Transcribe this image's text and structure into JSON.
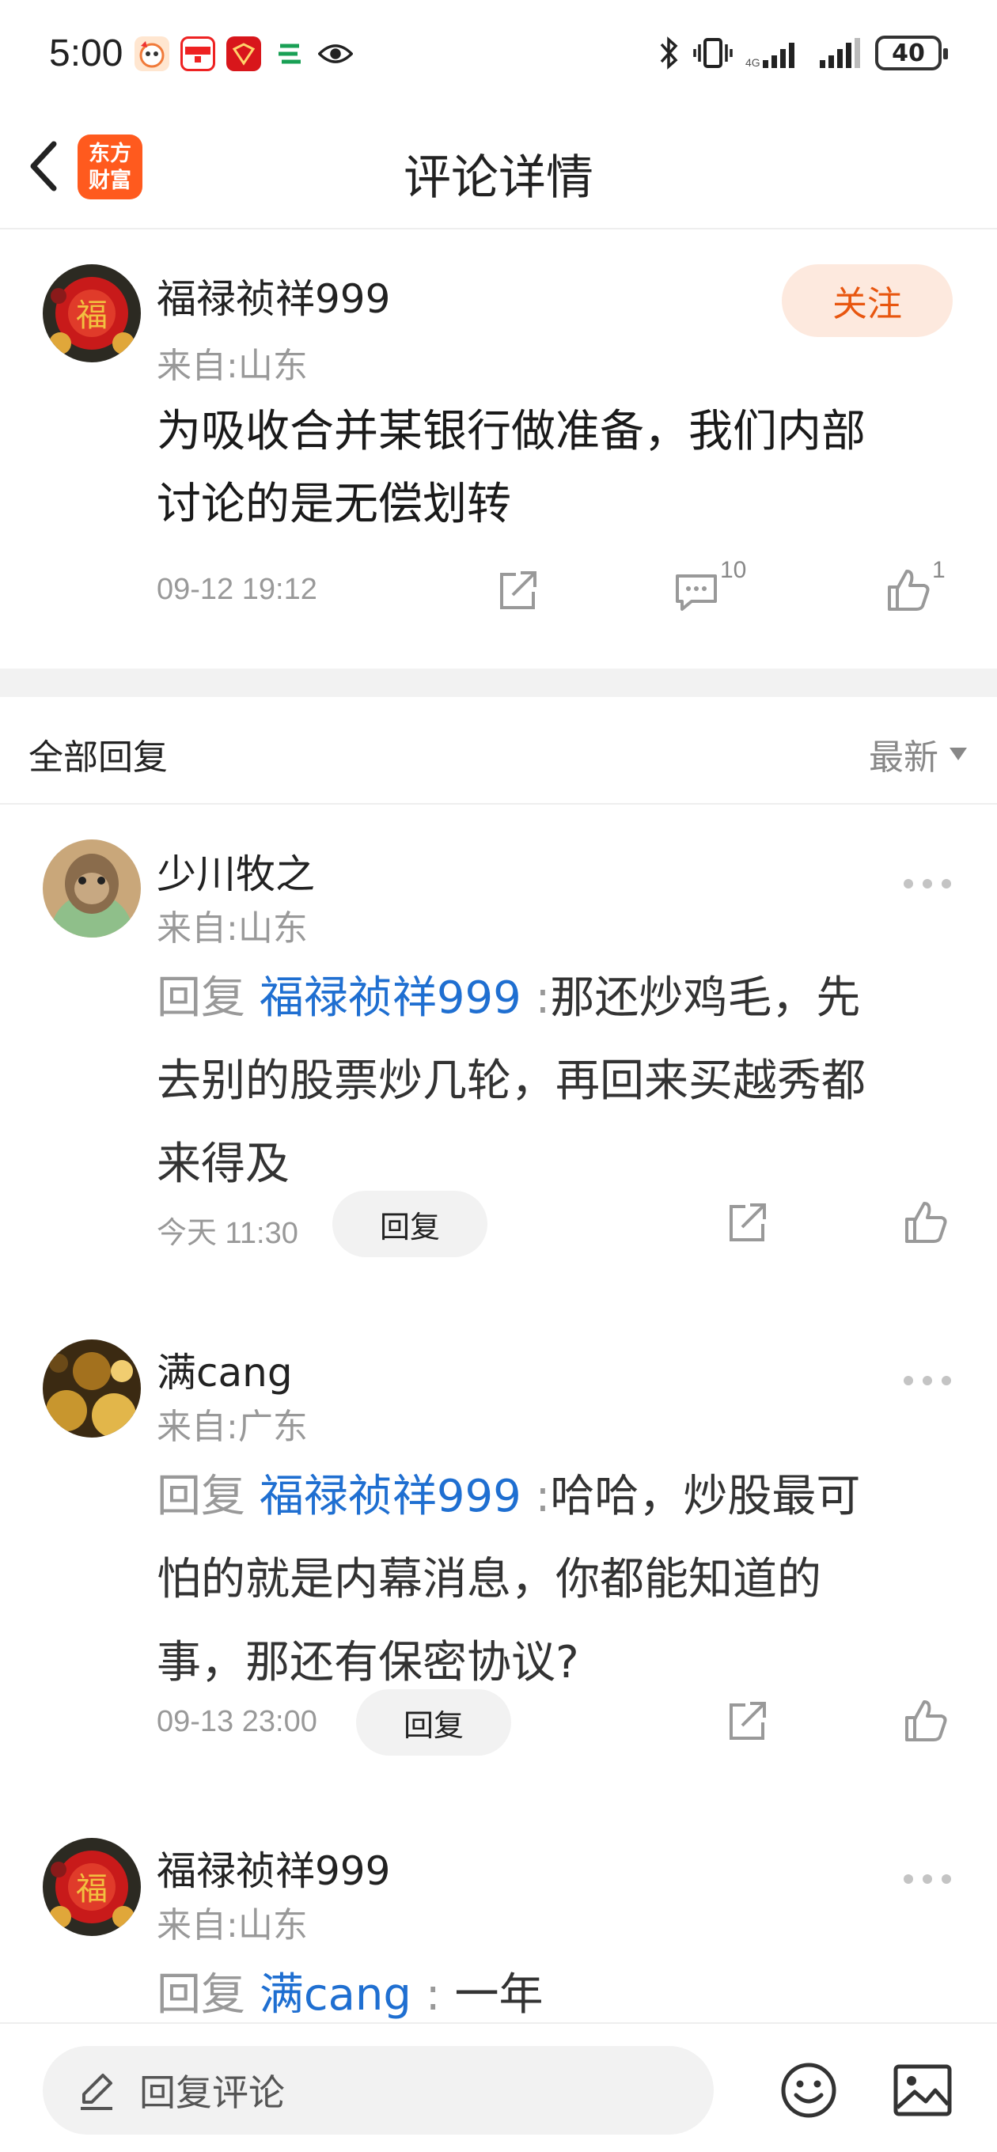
{
  "status_bar": {
    "time": "5:00",
    "battery": "40",
    "app_icons": [
      "weibo-like-app-icon",
      "yunshanfu-app-icon",
      "gift-app-icon",
      "bank-app-icon",
      "eye-icon"
    ]
  },
  "header": {
    "title": "评论详情",
    "logo_line1": "东方",
    "logo_line2": "财富"
  },
  "post": {
    "username": "福禄祯祥999",
    "location": "来自:山东",
    "follow_label": "关注",
    "text_line1": "为吸收合并某银行做准备，我们内部",
    "text_line2": "讨论的是无偿划转",
    "time": "09-12 19:12",
    "comment_count": "10",
    "like_count": "1"
  },
  "replies_header": {
    "label": "全部回复",
    "sort": "最新"
  },
  "replies": [
    {
      "username": "少川牧之",
      "location": "来自:山东",
      "prefix": "回复",
      "mention": "福禄祯祥999",
      "colon": ":",
      "text_line1": "那还炒鸡毛，先",
      "text_line2": "去别的股票炒几轮，再回来买越秀都",
      "text_line3": "来得及",
      "time": "今天 11:30",
      "reply_label": "回复"
    },
    {
      "username": "满cang",
      "location": "来自:广东",
      "prefix": "回复",
      "mention": "福禄祯祥999",
      "colon": ":",
      "text_line1": "哈哈，炒股最可",
      "text_line2": "怕的就是内幕消息，你都能知道的",
      "text_line3": "事，那还有保密协议?",
      "time": "09-13 23:00",
      "reply_label": "回复"
    },
    {
      "username": "福禄祯祥999",
      "location": "来自:山东",
      "prefix": "回复",
      "mention": "满cang",
      "colon": ":",
      "text_line1": "一年"
    }
  ],
  "bottom_bar": {
    "input_label": "回复评论"
  },
  "colors": {
    "accent": "#e8560f",
    "mention": "#1f6fd1",
    "follow_bg": "#fde9de",
    "logo": "#ff5a1e"
  }
}
